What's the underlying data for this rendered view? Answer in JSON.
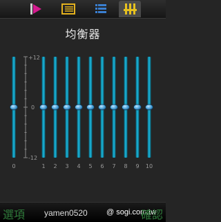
{
  "tabs": [
    {
      "icon": "play-flag-icon",
      "active": false
    },
    {
      "icon": "list-icon",
      "active": false
    },
    {
      "icon": "menu-lines-icon",
      "active": false
    },
    {
      "icon": "equalizer-icon",
      "active": true
    }
  ],
  "title": "均衡器",
  "scale": {
    "top": "+12",
    "middle": "0",
    "bottom": "-12",
    "min": -12,
    "max": 12
  },
  "bands": [
    {
      "label": "0",
      "level": 0
    },
    {
      "label": "1",
      "level": 0
    },
    {
      "label": "2",
      "level": 0
    },
    {
      "label": "3",
      "level": 0
    },
    {
      "label": "4",
      "level": 0
    },
    {
      "label": "5",
      "level": 0
    },
    {
      "label": "6",
      "level": 0
    },
    {
      "label": "7",
      "level": 0
    },
    {
      "label": "8",
      "level": 0
    },
    {
      "label": "9",
      "level": 0
    },
    {
      "label": "10",
      "level": 0
    }
  ],
  "softkeys": {
    "left": "選項",
    "center": "yamen0520",
    "watermark": "@ sogi.com.tw",
    "right": "確認"
  },
  "colors": {
    "slider": "#18a7c9",
    "slider_dark": "#0a5d74",
    "knob": "#4aa0d8",
    "softkey": "#2f7a3a"
  }
}
